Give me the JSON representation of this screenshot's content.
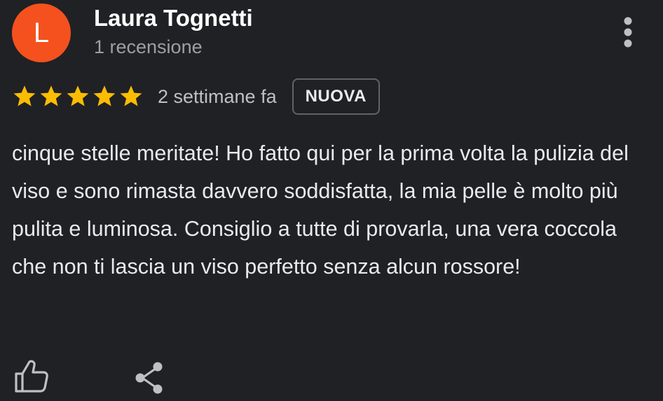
{
  "review": {
    "avatar_letter": "L",
    "avatar_color": "#f4511e",
    "reviewer_name": "Laura Tognetti",
    "review_count": "1 recensione",
    "rating": 5,
    "rating_max": 5,
    "star_color": "#fbbc04",
    "date": "2 settimane fa",
    "badge": "NUOVA",
    "text": "cinque stelle meritate! Ho fatto qui per la prima volta la pulizia del viso e sono rimasta davvero soddisfatta, la mia pelle è molto più pulita e luminosa. Consiglio a tutte di provarla, una vera coccola che non ti lascia un viso perfetto senza alcun rossore!"
  },
  "actions": {
    "more_icon": "more-vert-icon",
    "like_icon": "thumb-up-icon",
    "share_icon": "share-icon"
  },
  "theme": {
    "background": "#202124",
    "text_primary": "#e8eaed",
    "text_secondary": "#9aa0a6"
  }
}
